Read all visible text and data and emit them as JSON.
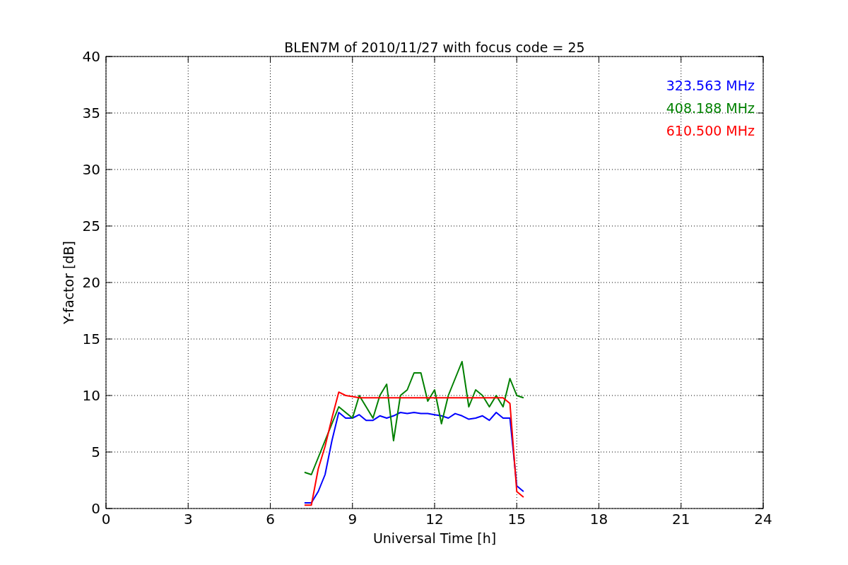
{
  "chart_data": {
    "type": "line",
    "title": "BLEN7M of 2010/11/27 with focus code = 25",
    "xlabel": "Universal Time [h]",
    "ylabel": "Y-factor [dB]",
    "x": [
      7.25,
      7.5,
      7.75,
      8,
      8.25,
      8.5,
      8.75,
      9,
      9.25,
      9.5,
      9.75,
      10,
      10.25,
      10.5,
      10.75,
      11,
      11.25,
      11.5,
      11.75,
      12,
      12.25,
      12.5,
      12.75,
      13,
      13.25,
      13.5,
      13.75,
      14,
      14.25,
      14.5,
      14.75,
      15,
      15.25
    ],
    "series": [
      {
        "name": "323.563 MHz",
        "color": "#0000ff",
        "values": [
          0.5,
          0.5,
          1.5,
          3,
          6,
          8.5,
          8,
          8,
          8.3,
          7.8,
          7.8,
          8.2,
          8,
          8.2,
          8.5,
          8.4,
          8.5,
          8.4,
          8.4,
          8.3,
          8.2,
          8,
          8.4,
          8.2,
          7.9,
          8,
          8.2,
          7.8,
          8.5,
          8,
          8,
          2,
          1.5
        ]
      },
      {
        "name": "408.188 MHz",
        "color": "#008000",
        "values": [
          3.2,
          3,
          4.5,
          6,
          7.5,
          9,
          8.5,
          8,
          10,
          9,
          8,
          10,
          11,
          6,
          10,
          10.5,
          12,
          12,
          9.5,
          10.5,
          7.5,
          10,
          11.5,
          13,
          9,
          10.5,
          10,
          9,
          10,
          9,
          11.5,
          10,
          9.8
        ]
      },
      {
        "name": "610.500 MHz",
        "color": "#ff0000",
        "values": [
          0.3,
          0.3,
          3.5,
          5.5,
          8,
          10.3,
          10,
          9.9,
          9.8,
          9.8,
          9.8,
          9.8,
          9.8,
          9.8,
          9.8,
          9.8,
          9.8,
          9.8,
          9.8,
          9.8,
          9.8,
          9.8,
          9.8,
          9.8,
          9.8,
          9.8,
          9.8,
          9.8,
          9.8,
          9.8,
          9.3,
          1.5,
          1
        ]
      }
    ],
    "xlim": [
      0,
      24
    ],
    "ylim": [
      0,
      40
    ],
    "xticks": [
      0,
      3,
      6,
      9,
      12,
      15,
      18,
      21,
      24
    ],
    "yticks": [
      0,
      5,
      10,
      15,
      20,
      25,
      30,
      35,
      40
    ],
    "grid": true
  }
}
